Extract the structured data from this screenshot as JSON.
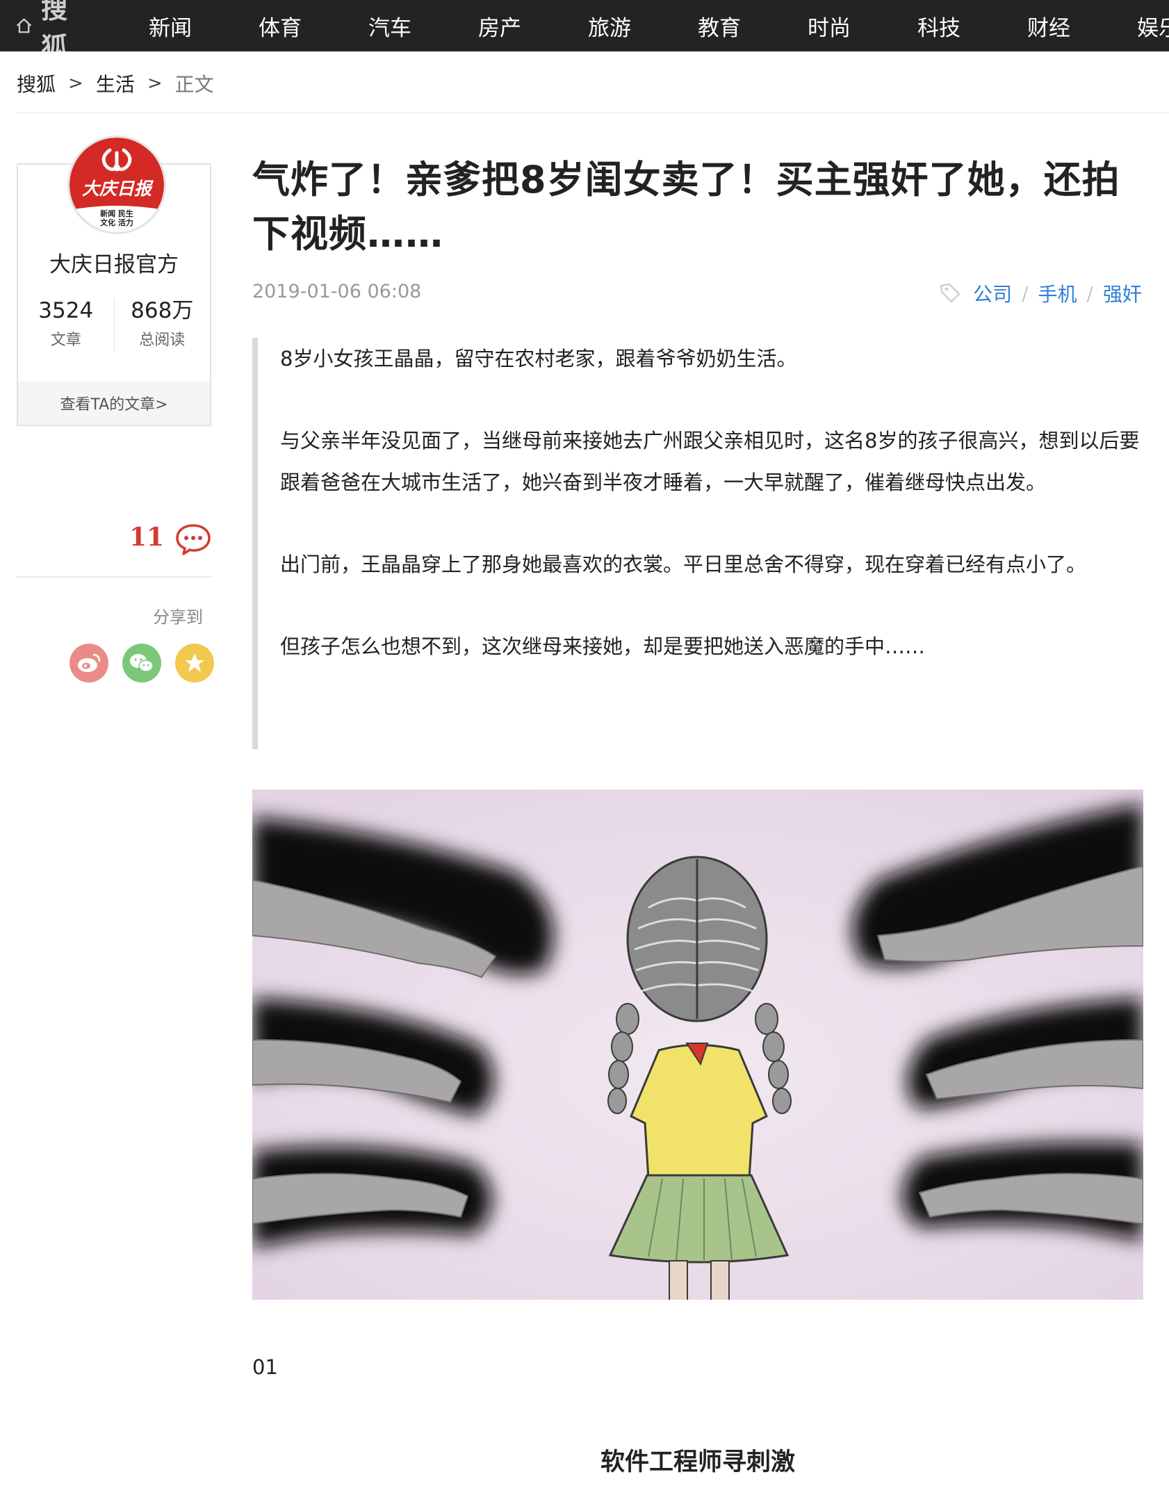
{
  "nav": {
    "brand": "搜狐",
    "items": [
      "新闻",
      "体育",
      "汽车",
      "房产",
      "旅游",
      "教育",
      "时尚",
      "科技",
      "财经",
      "娱乐"
    ]
  },
  "breadcrumb": {
    "items": [
      "搜狐",
      "生活",
      "正文"
    ],
    "separator": ">"
  },
  "author": {
    "name": "大庆日报官方",
    "logo_text": "大庆日报",
    "logo_sub1": "新闻 民生",
    "logo_sub2": "文化 活力",
    "articles_count": "3524",
    "articles_label": "文章",
    "reads_count": "868万",
    "reads_label": "总阅读",
    "view_link": "查看TA的文章>"
  },
  "comments": {
    "count": "11"
  },
  "share": {
    "label": "分享到",
    "targets": [
      "weibo-icon",
      "wechat-icon",
      "favorite-icon"
    ]
  },
  "article": {
    "title": "气炸了！亲爹把8岁闺女卖了！买主强奸了她，还拍下视频……",
    "date": "2019-01-06 06:08",
    "tags": [
      "公司",
      "手机",
      "强奸"
    ],
    "paragraphs": [
      "8岁小女孩王晶晶，留守在农村老家，跟着爷爷奶奶生活。",
      "与父亲半年没见面了，当继母前来接她去广州跟父亲相见时，这名8岁的孩子很高兴，想到以后要跟着爸爸在大城市生活了，她兴奋到半夜才睡着，一大早就醒了，催着继母快点出发。",
      "出门前，王晶晶穿上了那身她最喜欢的衣裳。平日里总舍不得穿，现在穿着已经有点小了。",
      "但孩子怎么也想不到，这次继母来接她，却是要把她送入恶魔的手中……"
    ],
    "section_number": "01",
    "section_title": "软件工程师寻刺激"
  },
  "colors": {
    "nav_bg": "#232323",
    "tag_link": "#2f7fd6",
    "comment_red": "#d23c2e"
  }
}
